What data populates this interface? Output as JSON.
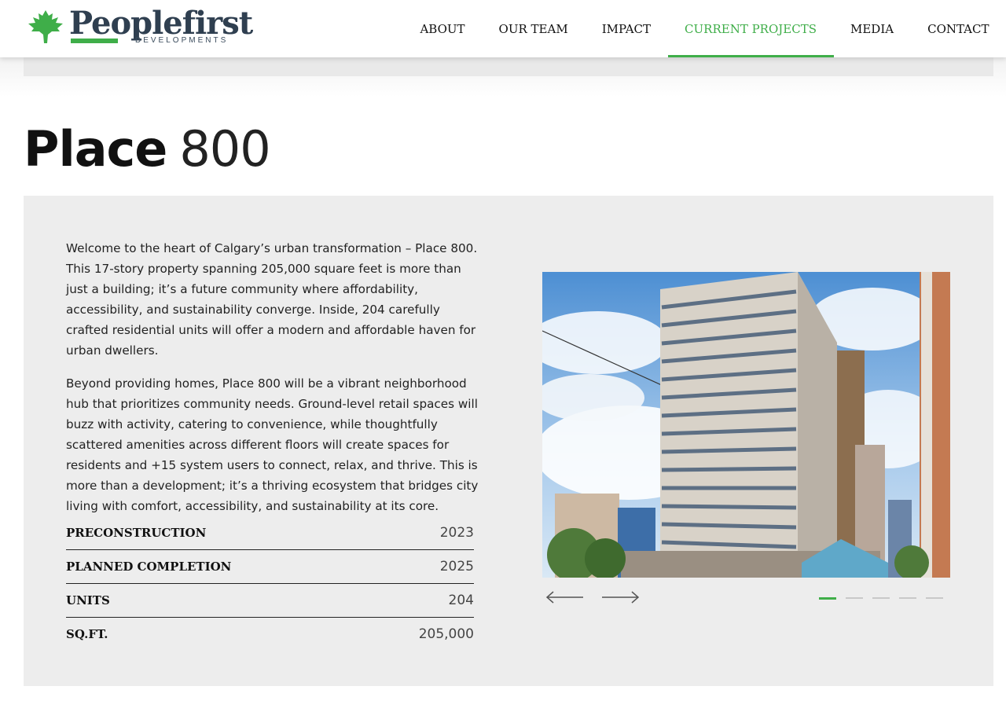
{
  "brand": {
    "name": "Peoplefirst",
    "tagline": "DEVELOPMENTS",
    "green": "#3fae49",
    "navy": "#2f3f50"
  },
  "nav": {
    "items": [
      {
        "label": "ABOUT",
        "active": false
      },
      {
        "label": "OUR TEAM",
        "active": false
      },
      {
        "label": "IMPACT",
        "active": false
      },
      {
        "label": "CURRENT PROJECTS",
        "active": true
      },
      {
        "label": "MEDIA",
        "active": false
      },
      {
        "label": "CONTACT",
        "active": false
      }
    ]
  },
  "project": {
    "title_bold": "Place",
    "title_light": "800",
    "paragraphs": [
      "Welcome to the heart of Calgary’s urban transformation – Place 800. This 17-story property spanning 205,000 square feet is more than just a building; it’s a future community where affordability, accessibility, and sustainability converge. Inside, 204 carefully crafted residential units will offer a modern and affordable haven for urban dwellers.",
      "Beyond providing homes, Place 800 will be a vibrant neighborhood hub that prioritizes community needs. Ground-level retail spaces will buzz with activity, catering to convenience, while thoughtfully scattered amenities across different floors will create spaces for residents and +15 system users to connect, relax, and thrive. This is more than a development; it’s a thriving ecosystem that bridges city living with comfort, accessibility, and sustainability at its core."
    ],
    "specs": [
      {
        "label": "PRECONSTRUCTION",
        "value": "2023"
      },
      {
        "label": "PLANNED COMPLETION",
        "value": "2025"
      },
      {
        "label": "UNITS",
        "value": "204"
      },
      {
        "label": "SQ.FT.",
        "value": "205,000"
      }
    ]
  },
  "carousel": {
    "slide_count": 5,
    "current_slide": 1,
    "prev_icon": "arrow-left-icon",
    "next_icon": "arrow-right-icon"
  }
}
